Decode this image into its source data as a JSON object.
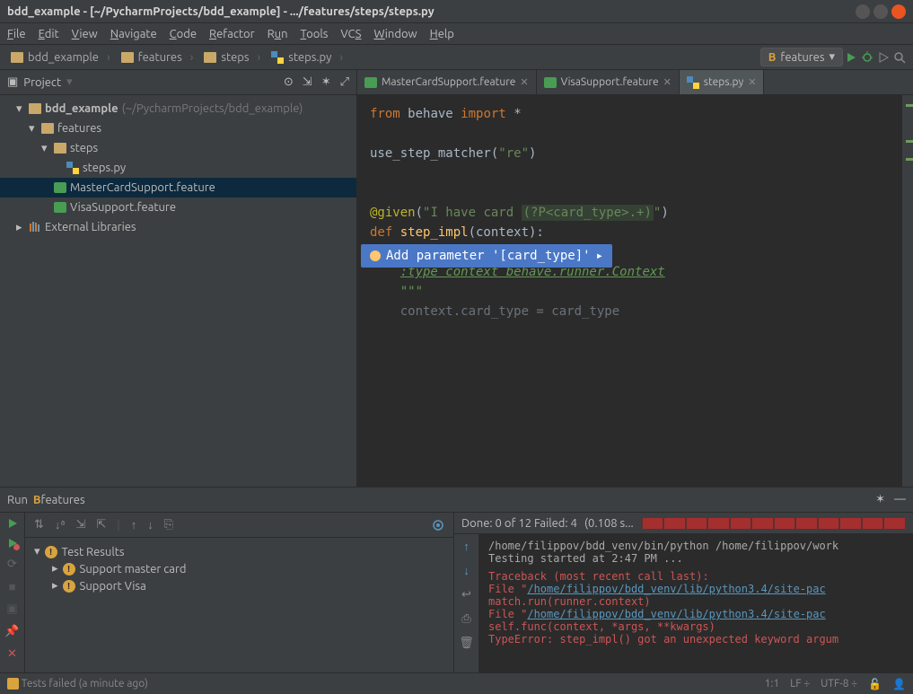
{
  "title": "bdd_example - [~/PycharmProjects/bdd_example] - .../features/steps/steps.py",
  "menu": [
    "File",
    "Edit",
    "View",
    "Navigate",
    "Code",
    "Refactor",
    "Run",
    "Tools",
    "VCS",
    "Window",
    "Help"
  ],
  "crumbs": [
    {
      "icon": "folder",
      "label": "bdd_example"
    },
    {
      "icon": "folder",
      "label": "features"
    },
    {
      "icon": "folder",
      "label": "steps"
    },
    {
      "icon": "py",
      "label": "steps.py"
    }
  ],
  "run_config": {
    "label": "features"
  },
  "project": {
    "view": "Project",
    "root": {
      "label": "bdd_example",
      "hint": "(~/PycharmProjects/bdd_example)"
    },
    "nodes": [
      {
        "depth": 2,
        "arrow": "▾",
        "icon": "folder",
        "label": "features"
      },
      {
        "depth": 3,
        "arrow": "▾",
        "icon": "folder",
        "label": "steps"
      },
      {
        "depth": 4,
        "arrow": "",
        "icon": "py",
        "label": "steps.py"
      },
      {
        "depth": 3,
        "arrow": "",
        "icon": "feat",
        "label": "MasterCardSupport.feature",
        "sel": true
      },
      {
        "depth": 3,
        "arrow": "",
        "icon": "feat",
        "label": "VisaSupport.feature"
      }
    ],
    "ext_lib": "External Libraries"
  },
  "tabs": [
    {
      "icon": "feat",
      "label": "MasterCardSupport.feature"
    },
    {
      "icon": "feat",
      "label": "VisaSupport.feature"
    },
    {
      "icon": "py",
      "label": "steps.py",
      "active": true
    }
  ],
  "code": {
    "l1_pre": "from ",
    "l1_mid": "behave ",
    "l1_kw": "import ",
    "l1_end": "*",
    "l3": "use_step_matcher(",
    "l3_str": "\"re\"",
    "l3_end": ")",
    "l6_dec": "@given",
    "l6_p": "(",
    "l6_s1": "\"I have card ",
    "l6_s2": "(?P<card_type>.+)",
    "l6_s3": "\"",
    "l6_pe": ")",
    "l7_def": "def ",
    "l7_fn": "step_impl",
    "l7_args": "(context):",
    "l8_doc": "\"\"\"",
    "l9_doc": ":type context behave.runner.Context",
    "l10_doc": "\"\"\"",
    "l11": "context.card_type = card_type"
  },
  "quickfix": "Add parameter '[card_type]'",
  "run_tab": {
    "label": "Run",
    "config": "features"
  },
  "tests": {
    "root": "Test Results",
    "items": [
      "Support master card",
      "Support Visa"
    ],
    "status": "Done: 0 of 12  Failed: 4",
    "time": "(0.108 s..."
  },
  "console": {
    "l1": "/home/filippov/bdd_venv/bin/python /home/filippov/work",
    "l2": "Testing started at 2:47 PM ...",
    "l3": "Traceback (most recent call last):",
    "l4a": "  File \"",
    "l4b": "/home/filippov/bdd_venv/lib/python3.4/site-pac",
    "l4c": "",
    "l5": "    match.run(runner.context)",
    "l6a": "  File \"",
    "l6b": "/home/filippov/bdd_venv/lib/python3.4/site-pac",
    "l7": "    self.func(context, *args, **kwargs)",
    "l8": "TypeError: step_impl() got an unexpected keyword argum"
  },
  "status": {
    "msg": "Tests failed (a minute ago)",
    "pos": "1:1",
    "le": "LF",
    "enc": "UTF-8"
  }
}
